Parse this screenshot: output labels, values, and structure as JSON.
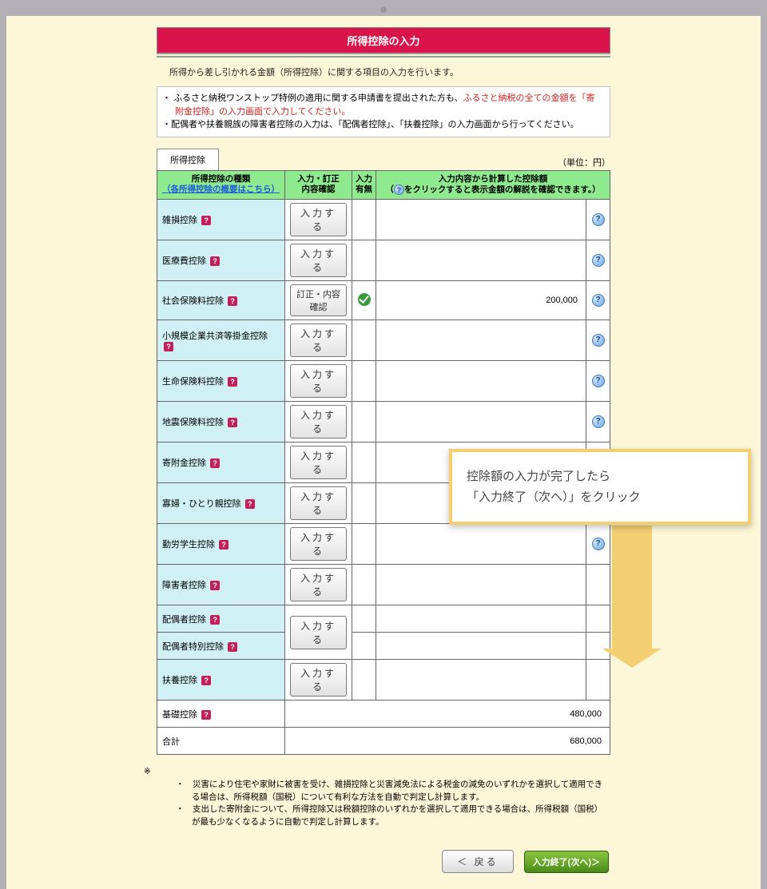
{
  "title": "所得控除の入力",
  "intro": "所得から差し引かれる金額（所得控除）に関する項目の入力を行います。",
  "notice": {
    "line1_a": "ふるさと納税ワンストップ特例の適用に関する申請書を提出された方も、",
    "line1_red": "ふるさと納税の全ての金額を「寄附金控除」の入力画面で入力してください。",
    "line2": "配偶者や扶養親族の障害者控除の入力は、「配偶者控除」、「扶養控除」の入力画面から行ってください。"
  },
  "tab": "所得控除",
  "unit": "（単位：円）",
  "headers": {
    "type": "所得控除の種類",
    "type_link": "（各所得控除の概要はこちら）",
    "input": "入力・訂正\n内容確認",
    "check": "入力\n有無",
    "amount_l1": "入力内容から計算した控除額",
    "amount_l2_a": "（",
    "amount_l2_b": "をクリックすると表示金額の解説を確認できます。）"
  },
  "btn_input": "入力する",
  "btn_correct": "訂正・内容確認",
  "rows": [
    {
      "name": "雑損控除",
      "help": true,
      "btn": "input",
      "check": false,
      "amount": "",
      "info": true
    },
    {
      "name": "医療費控除",
      "help": true,
      "btn": "input",
      "check": false,
      "amount": "",
      "info": true
    },
    {
      "name": "社会保険料控除",
      "help": true,
      "btn": "correct",
      "check": true,
      "amount": "200,000",
      "info": true
    },
    {
      "name": "小規模企業共済等掛金控除",
      "help": true,
      "btn": "input",
      "check": false,
      "amount": "",
      "info": true
    },
    {
      "name": "生命保険料控除",
      "help": true,
      "btn": "input",
      "check": false,
      "amount": "",
      "info": true
    },
    {
      "name": "地震保険料控除",
      "help": true,
      "btn": "input",
      "check": false,
      "amount": "",
      "info": true
    },
    {
      "name": "寄附金控除",
      "help": true,
      "btn": "input",
      "check": false,
      "amount": "",
      "info": true
    },
    {
      "name": "寡婦・ひとり親控除",
      "help": true,
      "btn": "input",
      "check": false,
      "amount": "",
      "info": true
    },
    {
      "name": "勤労学生控除",
      "help": true,
      "btn": "input",
      "check": false,
      "amount": "",
      "info": true
    },
    {
      "name": "障害者控除",
      "help": true,
      "btn": "input",
      "check": false,
      "amount": "",
      "info": false
    },
    {
      "name": "配偶者控除",
      "help": true,
      "btn": "input_merge",
      "check": false,
      "amount": "",
      "info": false
    },
    {
      "name": "配偶者特別控除",
      "help": true,
      "btn": "",
      "check": false,
      "amount": "",
      "info": false
    },
    {
      "name": "扶養控除",
      "help": true,
      "btn": "input",
      "check": false,
      "amount": "",
      "info": false
    }
  ],
  "basic": {
    "name": "基礎控除",
    "help": true,
    "amount": "480,000"
  },
  "total": {
    "name": "合計",
    "amount": "680,000"
  },
  "footnote_prefix": "※",
  "footnotes": [
    "災害により住宅や家財に被害を受け、雑損控除と災害減免法による税金の減免のいずれかを選択して適用できる場合は、所得税額（国税）について有利な方法を自動で判定し計算します。",
    "支出した寄附金について、所得控除又は税額控除のいずれかを選択して適用できる場合は、所得税額（国税）が最も少なくなるように自動で判定し計算します。"
  ],
  "btn_back": "＜ 戻る",
  "btn_next": "入力終了(次へ)＞",
  "callout": {
    "line1": "控除額の入力が完了したら",
    "line2": "「入力終了（次へ）」をクリック"
  }
}
